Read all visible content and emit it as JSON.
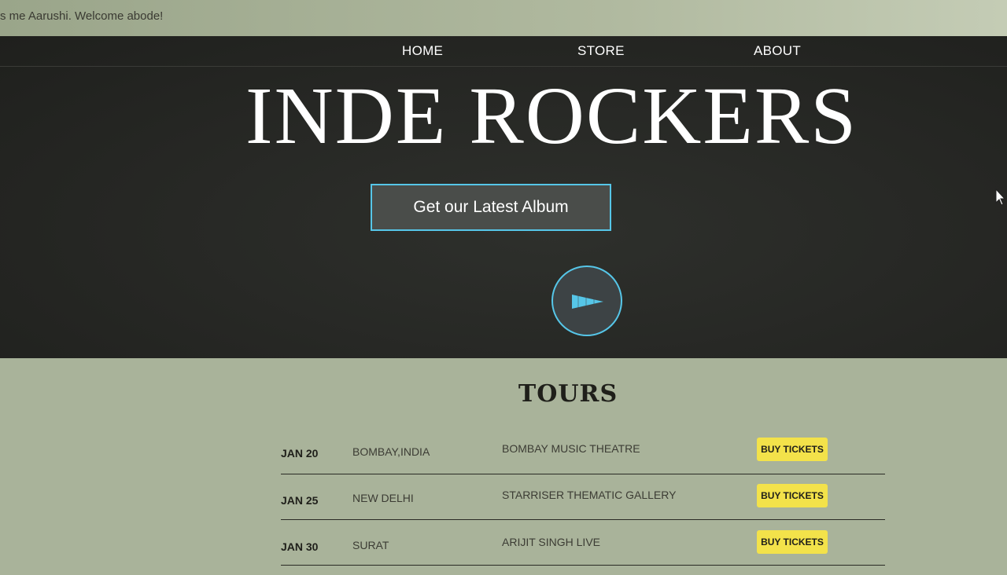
{
  "topbar": {
    "text": "s me Aarushi. Welcome abode!"
  },
  "nav": {
    "items": [
      "HOME",
      "STORE",
      "ABOUT"
    ]
  },
  "hero": {
    "title": "INDE ROCKERS",
    "album_button": "Get our Latest Album"
  },
  "tours": {
    "title": "TOURS",
    "rows": [
      {
        "date": "JAN 20",
        "city": "BOMBAY,INDIA",
        "venue": "BOMBAY MUSIC THEATRE",
        "button": "BUY TICKETS"
      },
      {
        "date": "JAN 25",
        "city": "NEW DELHI",
        "venue": "STARRISER THEMATIC GALLERY",
        "button": "BUY TICKETS"
      },
      {
        "date": "JAN 30",
        "city": "SURAT",
        "venue": "ARIJIT SINGH LIVE",
        "button": "BUY TICKETS"
      }
    ]
  },
  "colors": {
    "accent": "#56c6e8",
    "ticket_button": "#f3e24a",
    "hero_bg": "#262724",
    "page_bg": "#a9b39a"
  },
  "icons": {
    "play": "play-icon",
    "cursor": "mouse-cursor-icon"
  }
}
